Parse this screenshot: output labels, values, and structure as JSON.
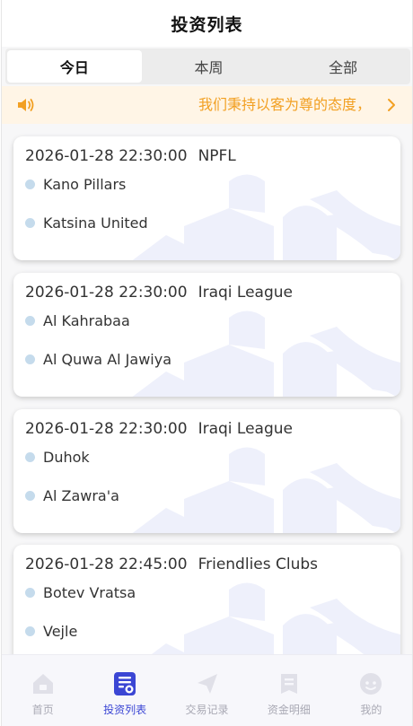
{
  "header": {
    "title": "投资列表"
  },
  "tabs": [
    {
      "label": "今日",
      "active": true
    },
    {
      "label": "本周",
      "active": false
    },
    {
      "label": "全部",
      "active": false
    }
  ],
  "notice": {
    "text": "我们秉持以客为尊的态度，"
  },
  "matches": [
    {
      "time": "2026-01-28 22:30:00",
      "league": "NPFL",
      "home": "Kano Pillars",
      "away": "Katsina United"
    },
    {
      "time": "2026-01-28 22:30:00",
      "league": "Iraqi League",
      "home": "Al Kahrabaa",
      "away": "Al Quwa Al Jawiya"
    },
    {
      "time": "2026-01-28 22:30:00",
      "league": "Iraqi League",
      "home": "Duhok",
      "away": "Al Zawra'a"
    },
    {
      "time": "2026-01-28 22:45:00",
      "league": "Friendlies Clubs",
      "home": "Botev Vratsa",
      "away": "Vejle"
    }
  ],
  "tabbar": [
    {
      "label": "首页",
      "icon": "home-icon",
      "active": false
    },
    {
      "label": "投资列表",
      "icon": "list-icon",
      "active": true
    },
    {
      "label": "交易记录",
      "icon": "send-icon",
      "active": false
    },
    {
      "label": "资金明细",
      "icon": "wallet-icon",
      "active": false
    },
    {
      "label": "我的",
      "icon": "profile-icon",
      "active": false
    }
  ],
  "colors": {
    "accent": "#3b46d4",
    "notice_text": "#f2a023",
    "notice_bg": "#fff5e6",
    "dot": "#c5dbec"
  }
}
